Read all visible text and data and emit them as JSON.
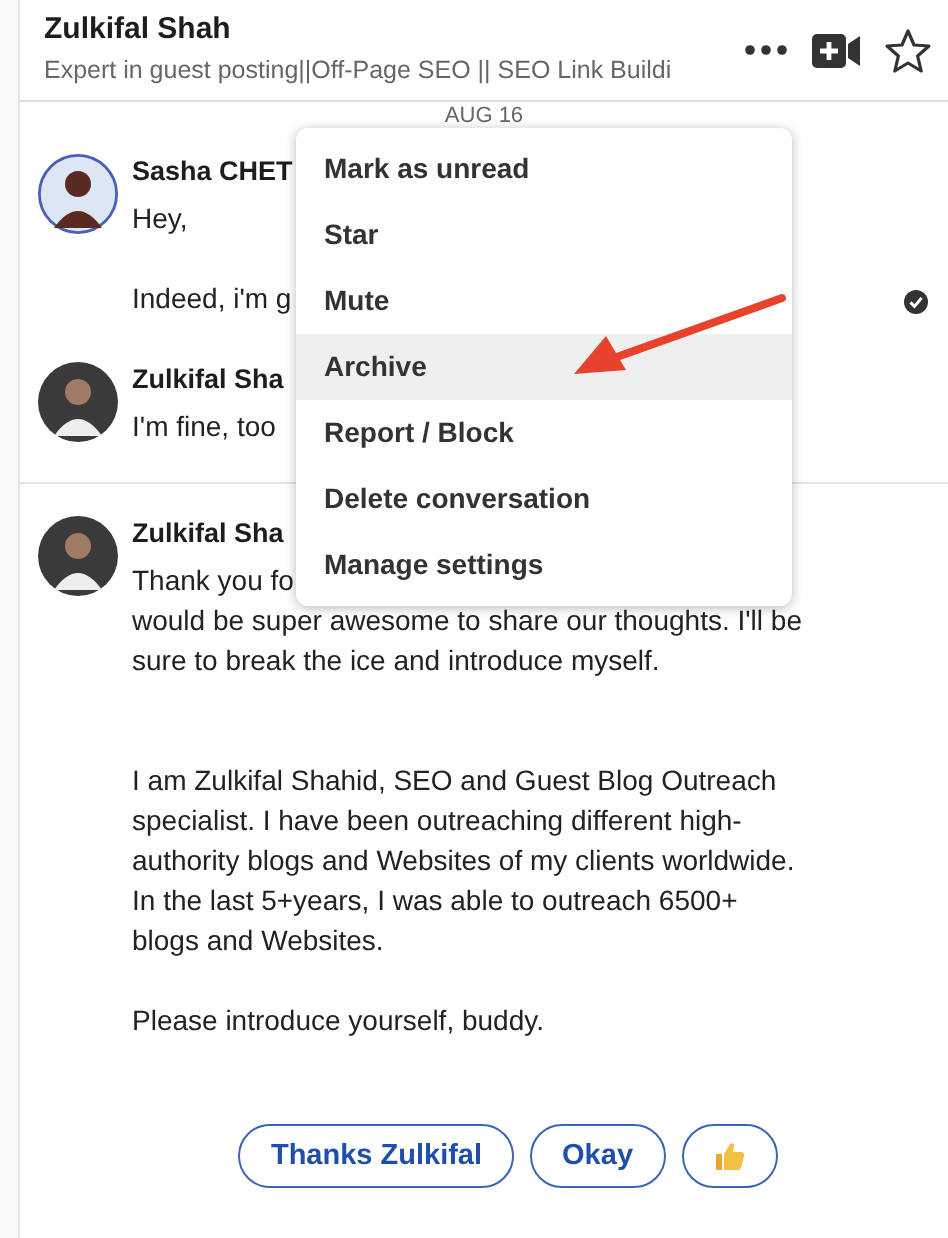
{
  "header": {
    "name": "Zulkifal Shah",
    "headline": "Expert in guest posting||Off-Page SEO || SEO Link Buildi"
  },
  "date": "AUG 16",
  "messages": [
    {
      "sender": "Sasha CHET",
      "ring": true,
      "divider": false,
      "seen": true,
      "paragraphs": [
        [
          "Hey,"
        ],
        [
          "Indeed, i'm g"
        ]
      ]
    },
    {
      "sender": "Zulkifal Sha",
      "ring": false,
      "divider": false,
      "seen": false,
      "paragraphs": [
        [
          "I'm fine, too"
        ]
      ]
    },
    {
      "sender": "Zulkifal Sha",
      "ring": false,
      "divider": true,
      "seen": false,
      "paragraphs": [
        [
          "Thank you fo",
          "would be super awesome to share our thoughts. I'll be",
          "sure to break the ice and introduce myself."
        ],
        [
          "I am Zulkifal Shahid, SEO and Guest Blog Outreach",
          "specialist. I have been outreaching different high-",
          "authority blogs and Websites of my clients worldwide.",
          "In the last 5+years, I was able to outreach 6500+",
          "blogs and Websites."
        ],
        [
          "Please introduce yourself, buddy."
        ]
      ]
    }
  ],
  "menu": {
    "items": [
      {
        "label": "Mark as unread",
        "selected": false
      },
      {
        "label": "Star",
        "selected": false
      },
      {
        "label": "Mute",
        "selected": false
      },
      {
        "label": "Archive",
        "selected": true
      },
      {
        "label": "Report / Block",
        "selected": false
      },
      {
        "label": "Delete conversation",
        "selected": false
      },
      {
        "label": "Manage settings",
        "selected": false
      }
    ]
  },
  "quick_replies": [
    {
      "kind": "text",
      "label": "Thanks Zulkifal"
    },
    {
      "kind": "text",
      "label": "Okay"
    },
    {
      "kind": "thumbs_up"
    }
  ]
}
